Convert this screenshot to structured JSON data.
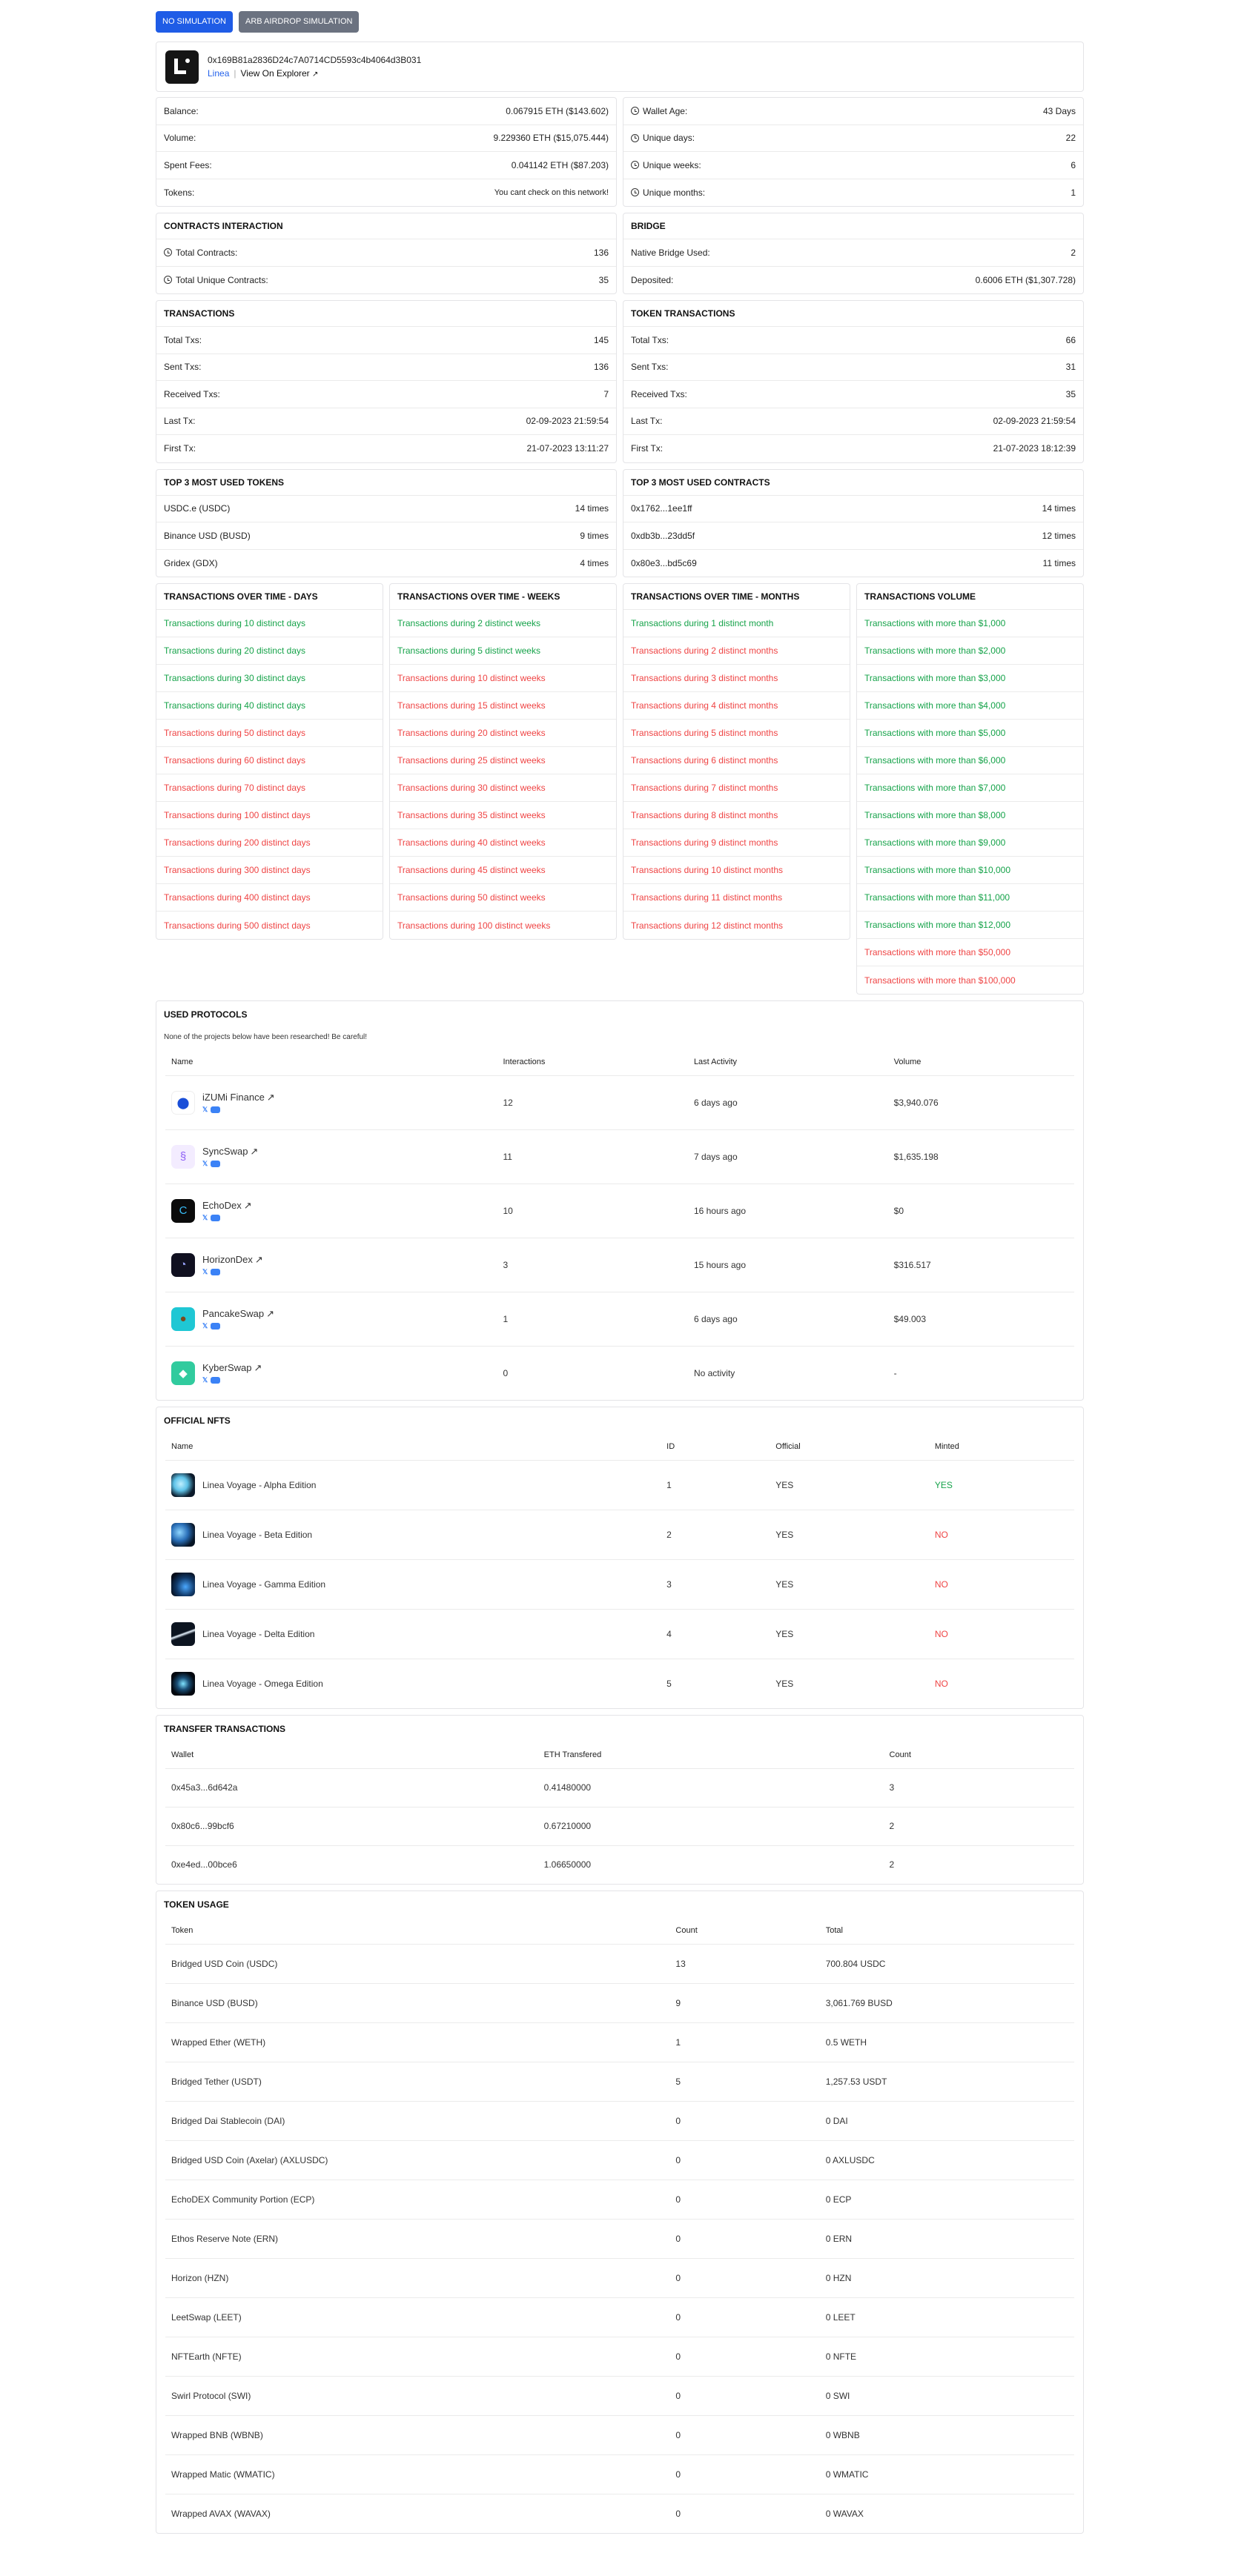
{
  "buttons": {
    "no_sim": "NO SIMULATION",
    "arb": "ARB AIRDROP SIMULATION"
  },
  "wallet": {
    "address": "0x169B81a2836D24c7A0714CD5593c4b4064d3B031",
    "network": "Linea",
    "explorer": "View On Explorer"
  },
  "overview_left": [
    {
      "label": "Balance:",
      "value": "0.067915 ETH ($143.602)"
    },
    {
      "label": "Volume:",
      "value": "9.229360 ETH ($15,075.444)"
    },
    {
      "label": "Spent Fees:",
      "value": "0.041142 ETH ($87.203)"
    },
    {
      "label": "Tokens:",
      "value": "You cant check on this network!"
    }
  ],
  "overview_right": [
    {
      "label": "Wallet Age:",
      "value": "43 Days"
    },
    {
      "label": "Unique days:",
      "value": "22"
    },
    {
      "label": "Unique weeks:",
      "value": "6"
    },
    {
      "label": "Unique months:",
      "value": "1"
    }
  ],
  "contracts": {
    "title": "CONTRACTS INTERACTION",
    "rows": [
      {
        "label": "Total Contracts:",
        "value": "136"
      },
      {
        "label": "Total Unique Contracts:",
        "value": "35"
      }
    ]
  },
  "bridge": {
    "title": "BRIDGE",
    "rows": [
      {
        "label": "Native Bridge Used:",
        "value": "2"
      },
      {
        "label": "Deposited:",
        "value": "0.6006 ETH ($1,307.728)"
      }
    ]
  },
  "transactions": {
    "title": "TRANSACTIONS",
    "rows": [
      {
        "label": "Total Txs:",
        "value": "145"
      },
      {
        "label": "Sent Txs:",
        "value": "136"
      },
      {
        "label": "Received Txs:",
        "value": "7"
      },
      {
        "label": "Last Tx:",
        "value": "02-09-2023 21:59:54"
      },
      {
        "label": "First Tx:",
        "value": "21-07-2023 13:11:27"
      }
    ]
  },
  "token_transactions": {
    "title": "TOKEN TRANSACTIONS",
    "rows": [
      {
        "label": "Total Txs:",
        "value": "66"
      },
      {
        "label": "Sent Txs:",
        "value": "31"
      },
      {
        "label": "Received Txs:",
        "value": "35"
      },
      {
        "label": "Last Tx:",
        "value": "02-09-2023 21:59:54"
      },
      {
        "label": "First Tx:",
        "value": "21-07-2023 18:12:39"
      }
    ]
  },
  "top_tokens": {
    "title": "TOP 3 MOST USED TOKENS",
    "rows": [
      {
        "label": "USDC.e (USDC)",
        "value": "14 times"
      },
      {
        "label": "Binance USD (BUSD)",
        "value": "9 times"
      },
      {
        "label": "Gridex (GDX)",
        "value": "4 times"
      }
    ]
  },
  "top_contracts": {
    "title": "TOP 3 MOST USED CONTRACTS",
    "rows": [
      {
        "label": "0x1762...1ee1ff",
        "value": "14 times"
      },
      {
        "label": "0xdb3b...23dd5f",
        "value": "12 times"
      },
      {
        "label": "0x80e3...bd5c69",
        "value": "11 times"
      }
    ]
  },
  "milestones": [
    {
      "title": "TRANSACTIONS OVER TIME - DAYS",
      "items": [
        {
          "text": "Transactions during 10 distinct days",
          "ok": true
        },
        {
          "text": "Transactions during 20 distinct days",
          "ok": true
        },
        {
          "text": "Transactions during 30 distinct days",
          "ok": true
        },
        {
          "text": "Transactions during 40 distinct days",
          "ok": true
        },
        {
          "text": "Transactions during 50 distinct days",
          "ok": false
        },
        {
          "text": "Transactions during 60 distinct days",
          "ok": false
        },
        {
          "text": "Transactions during 70 distinct days",
          "ok": false
        },
        {
          "text": "Transactions during 100 distinct days",
          "ok": false
        },
        {
          "text": "Transactions during 200 distinct days",
          "ok": false
        },
        {
          "text": "Transactions during 300 distinct days",
          "ok": false
        },
        {
          "text": "Transactions during 400 distinct days",
          "ok": false
        },
        {
          "text": "Transactions during 500 distinct days",
          "ok": false
        }
      ]
    },
    {
      "title": "TRANSACTIONS OVER TIME - WEEKS",
      "items": [
        {
          "text": "Transactions during 2 distinct weeks",
          "ok": true
        },
        {
          "text": "Transactions during 5 distinct weeks",
          "ok": true
        },
        {
          "text": "Transactions during 10 distinct weeks",
          "ok": false
        },
        {
          "text": "Transactions during 15 distinct weeks",
          "ok": false
        },
        {
          "text": "Transactions during 20 distinct weeks",
          "ok": false
        },
        {
          "text": "Transactions during 25 distinct weeks",
          "ok": false
        },
        {
          "text": "Transactions during 30 distinct weeks",
          "ok": false
        },
        {
          "text": "Transactions during 35 distinct weeks",
          "ok": false
        },
        {
          "text": "Transactions during 40 distinct weeks",
          "ok": false
        },
        {
          "text": "Transactions during 45 distinct weeks",
          "ok": false
        },
        {
          "text": "Transactions during 50 distinct weeks",
          "ok": false
        },
        {
          "text": "Transactions during 100 distinct weeks",
          "ok": false
        }
      ]
    },
    {
      "title": "TRANSACTIONS OVER TIME - MONTHS",
      "items": [
        {
          "text": "Transactions during 1 distinct month",
          "ok": true
        },
        {
          "text": "Transactions during 2 distinct months",
          "ok": false
        },
        {
          "text": "Transactions during 3 distinct months",
          "ok": false
        },
        {
          "text": "Transactions during 4 distinct months",
          "ok": false
        },
        {
          "text": "Transactions during 5 distinct months",
          "ok": false
        },
        {
          "text": "Transactions during 6 distinct months",
          "ok": false
        },
        {
          "text": "Transactions during 7 distinct months",
          "ok": false
        },
        {
          "text": "Transactions during 8 distinct months",
          "ok": false
        },
        {
          "text": "Transactions during 9 distinct months",
          "ok": false
        },
        {
          "text": "Transactions during 10 distinct months",
          "ok": false
        },
        {
          "text": "Transactions during 11 distinct months",
          "ok": false
        },
        {
          "text": "Transactions during 12 distinct months",
          "ok": false
        }
      ]
    },
    {
      "title": "TRANSACTIONS VOLUME",
      "items": [
        {
          "text": "Transactions with more than $1,000",
          "ok": true
        },
        {
          "text": "Transactions with more than $2,000",
          "ok": true
        },
        {
          "text": "Transactions with more than $3,000",
          "ok": true
        },
        {
          "text": "Transactions with more than $4,000",
          "ok": true
        },
        {
          "text": "Transactions with more than $5,000",
          "ok": true
        },
        {
          "text": "Transactions with more than $6,000",
          "ok": true
        },
        {
          "text": "Transactions with more than $7,000",
          "ok": true
        },
        {
          "text": "Transactions with more than $8,000",
          "ok": true
        },
        {
          "text": "Transactions with more than $9,000",
          "ok": true
        },
        {
          "text": "Transactions with more than $10,000",
          "ok": true
        },
        {
          "text": "Transactions with more than $11,000",
          "ok": true
        },
        {
          "text": "Transactions with more than $12,000",
          "ok": true
        },
        {
          "text": "Transactions with more than $50,000",
          "ok": false
        },
        {
          "text": "Transactions with more than $100,000",
          "ok": false
        }
      ]
    }
  ],
  "protocols": {
    "title": "USED PROTOCOLS",
    "note": "None of the projects below have been researched! Be careful!",
    "headers": [
      "Name",
      "Interactions",
      "Last Activity",
      "Volume"
    ],
    "rows": [
      {
        "name": "iZUMi Finance",
        "interactions": "12",
        "last": "6 days ago",
        "volume": "$3,940.076",
        "icon": "izumi-icon",
        "color": "#ffffff",
        "fg": "#1a4fd8",
        "glyph": "⬤"
      },
      {
        "name": "SyncSwap",
        "interactions": "11",
        "last": "7 days ago",
        "volume": "$1,635.198",
        "icon": "syncswap-icon",
        "color": "#f3ecff",
        "fg": "#8b5cf6",
        "glyph": "§"
      },
      {
        "name": "EchoDex",
        "interactions": "10",
        "last": "16 hours ago",
        "volume": "$0",
        "icon": "echodex-icon",
        "color": "#0b0b0b",
        "fg": "#38bdf8",
        "glyph": "C"
      },
      {
        "name": "HorizonDex",
        "interactions": "3",
        "last": "15 hours ago",
        "volume": "$316.517",
        "icon": "horizondex-icon",
        "color": "#101020",
        "fg": "#9aa4ff",
        "glyph": "◔"
      },
      {
        "name": "PancakeSwap",
        "interactions": "1",
        "last": "6 days ago",
        "volume": "$49.003",
        "icon": "pancakeswap-icon",
        "color": "#1fc7d4",
        "fg": "#7a4b1e",
        "glyph": "●"
      },
      {
        "name": "KyberSwap",
        "interactions": "0",
        "last": "No activity",
        "volume": "-",
        "icon": "kyberswap-icon",
        "color": "#31cb9e",
        "fg": "#ffffff",
        "glyph": "◆"
      }
    ]
  },
  "nfts": {
    "title": "OFFICIAL NFTS",
    "headers": [
      "Name",
      "ID",
      "Official",
      "Minted"
    ],
    "rows": [
      {
        "name": "Linea Voyage - Alpha Edition",
        "id": "1",
        "official": "YES",
        "minted": "YES",
        "ok": true
      },
      {
        "name": "Linea Voyage - Beta Edition",
        "id": "2",
        "official": "YES",
        "minted": "NO",
        "ok": false
      },
      {
        "name": "Linea Voyage - Gamma Edition",
        "id": "3",
        "official": "YES",
        "minted": "NO",
        "ok": false
      },
      {
        "name": "Linea Voyage - Delta Edition",
        "id": "4",
        "official": "YES",
        "minted": "NO",
        "ok": false
      },
      {
        "name": "Linea Voyage - Omega Edition",
        "id": "5",
        "official": "YES",
        "minted": "NO",
        "ok": false
      }
    ]
  },
  "transfers": {
    "title": "TRANSFER TRANSACTIONS",
    "headers": [
      "Wallet",
      "ETH Transfered",
      "Count"
    ],
    "rows": [
      {
        "wallet": "0x45a3...6d642a",
        "eth": "0.41480000",
        "count": "3"
      },
      {
        "wallet": "0x80c6...99bcf6",
        "eth": "0.67210000",
        "count": "2"
      },
      {
        "wallet": "0xe4ed...00bce6",
        "eth": "1.06650000",
        "count": "2"
      }
    ]
  },
  "token_usage": {
    "title": "TOKEN USAGE",
    "headers": [
      "Token",
      "Count",
      "Total"
    ],
    "rows": [
      {
        "token": "Bridged USD Coin (USDC)",
        "count": "13",
        "total": "700.804 USDC"
      },
      {
        "token": "Binance USD (BUSD)",
        "count": "9",
        "total": "3,061.769 BUSD"
      },
      {
        "token": "Wrapped Ether (WETH)",
        "count": "1",
        "total": "0.5 WETH"
      },
      {
        "token": "Bridged Tether (USDT)",
        "count": "5",
        "total": "1,257.53 USDT"
      },
      {
        "token": "Bridged Dai Stablecoin (DAI)",
        "count": "0",
        "total": "0 DAI"
      },
      {
        "token": "Bridged USD Coin (Axelar) (AXLUSDC)",
        "count": "0",
        "total": "0 AXLUSDC"
      },
      {
        "token": "EchoDEX Community Portion (ECP)",
        "count": "0",
        "total": "0 ECP"
      },
      {
        "token": "Ethos Reserve Note (ERN)",
        "count": "0",
        "total": "0 ERN"
      },
      {
        "token": "Horizon (HZN)",
        "count": "0",
        "total": "0 HZN"
      },
      {
        "token": "LeetSwap (LEET)",
        "count": "0",
        "total": "0 LEET"
      },
      {
        "token": "NFTEarth (NFTE)",
        "count": "0",
        "total": "0 NFTE"
      },
      {
        "token": "Swirl Protocol (SWI)",
        "count": "0",
        "total": "0 SWI"
      },
      {
        "token": "Wrapped BNB (WBNB)",
        "count": "0",
        "total": "0 WBNB"
      },
      {
        "token": "Wrapped Matic (WMATIC)",
        "count": "0",
        "total": "0 WMATIC"
      },
      {
        "token": "Wrapped AVAX (WAVAX)",
        "count": "0",
        "total": "0 WAVAX"
      }
    ]
  },
  "colors": {
    "accent": "#1f5ce6",
    "ok": "#16a34a",
    "fail": "#ef4444"
  }
}
